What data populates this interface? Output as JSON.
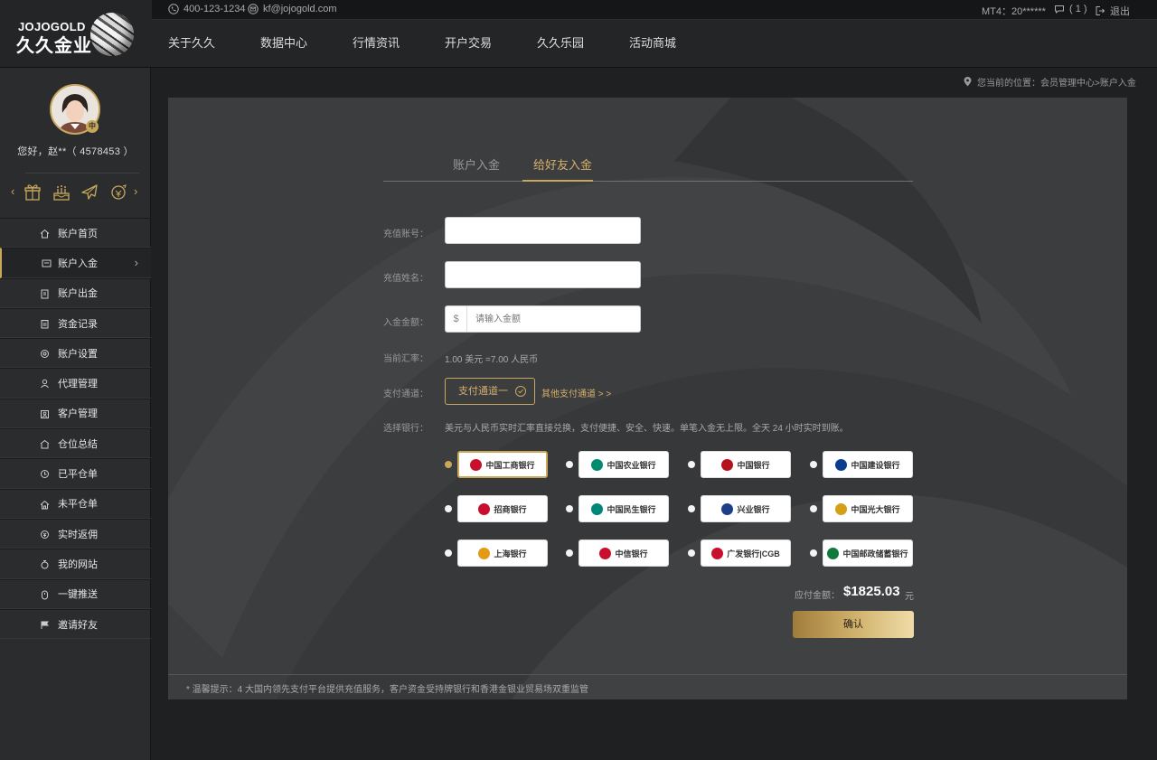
{
  "brand": {
    "name_en": "JOJOGOLD",
    "name_cn": "久久金业"
  },
  "topbar": {
    "phone": "400-123-1234",
    "email": "kf@jojogold.com",
    "account": "MT4：20******",
    "messages": "( 1 )",
    "logout": "退出"
  },
  "nav": [
    "关于久久",
    "数据中心",
    "行情资讯",
    "开户交易",
    "久久乐园",
    "活动商城"
  ],
  "user": {
    "greeting": "您好，赵**（ 4578453 ）",
    "badge": "中"
  },
  "sidebar": {
    "quick_icons": [
      "gift-icon",
      "cake-icon",
      "plane-icon",
      "bonus-icon"
    ],
    "items": [
      {
        "label": "账户首页",
        "icon": "home-icon"
      },
      {
        "label": "账户入金",
        "icon": "deposit-icon",
        "active": true
      },
      {
        "label": "账户出金",
        "icon": "withdraw-icon"
      },
      {
        "label": "资金记录",
        "icon": "record-icon"
      },
      {
        "label": "账户设置",
        "icon": "settings-icon"
      },
      {
        "label": "代理管理",
        "icon": "user-icon"
      },
      {
        "label": "客户管理",
        "icon": "customer-icon"
      },
      {
        "label": "仓位总结",
        "icon": "position-icon"
      },
      {
        "label": "已平仓单",
        "icon": "closed-order-icon"
      },
      {
        "label": "未平仓单",
        "icon": "open-order-icon"
      },
      {
        "label": "实时返佣",
        "icon": "commission-icon"
      },
      {
        "label": "我的网站",
        "icon": "website-icon"
      },
      {
        "label": "一键推送",
        "icon": "push-icon"
      },
      {
        "label": "邀请好友",
        "icon": "flag-icon"
      }
    ]
  },
  "breadcrumb": "您当前的位置：会员管理中心>账户入金",
  "tabs": [
    "账户入金",
    "给好友入金"
  ],
  "form": {
    "account_label": "充值账号：",
    "account_value": "",
    "name_label": "充值姓名：",
    "name_value": "",
    "amount_label": "入金金额：",
    "amount_prefix": "$",
    "amount_placeholder": "请输入金额",
    "rate_label": "当前汇率：",
    "rate_value": "1.00 美元 =7.00 人民币",
    "channel_label": "支付通道：",
    "channel_selected": "支付通道一",
    "channel_other": "其他支付通道 > >",
    "bank_label": "选择银行：",
    "bank_note": "美元与人民币实时汇率直接兑换，支付便捷、安全、快速。单笔入金无上限。全天 24 小时实时到账。"
  },
  "banks": [
    {
      "name": "中国工商银行",
      "color": "#c8102e",
      "selected": true
    },
    {
      "name": "中国农业银行",
      "color": "#008c6e"
    },
    {
      "name": "中国银行",
      "color": "#b5121b"
    },
    {
      "name": "中国建设银行",
      "color": "#0a3e8c"
    },
    {
      "name": "招商银行",
      "color": "#c8102e"
    },
    {
      "name": "中国民生银行",
      "color": "#00857a"
    },
    {
      "name": "兴业银行",
      "color": "#1d3f8a"
    },
    {
      "name": "中国光大银行",
      "color": "#d4a017"
    },
    {
      "name": "上海银行",
      "color": "#e39b15"
    },
    {
      "name": "中信银行",
      "color": "#c8102e"
    },
    {
      "name": "广发银行|CGB",
      "color": "#c8102e"
    },
    {
      "name": "中国邮政储蓄银行",
      "color": "#0f7a3c"
    }
  ],
  "payment": {
    "label": "应付金额：",
    "amount": "$1825.03",
    "unit": "元"
  },
  "confirm_label": "确认",
  "tip": "* 温馨提示：4 大国内领先支付平台提供充值服务，客户资金受持牌银行和香港金银业贸易场双重监管",
  "colors": {
    "gold": "#c9a75a",
    "panel": "#3b3d3f",
    "sidebar": "#2a2c2e"
  }
}
